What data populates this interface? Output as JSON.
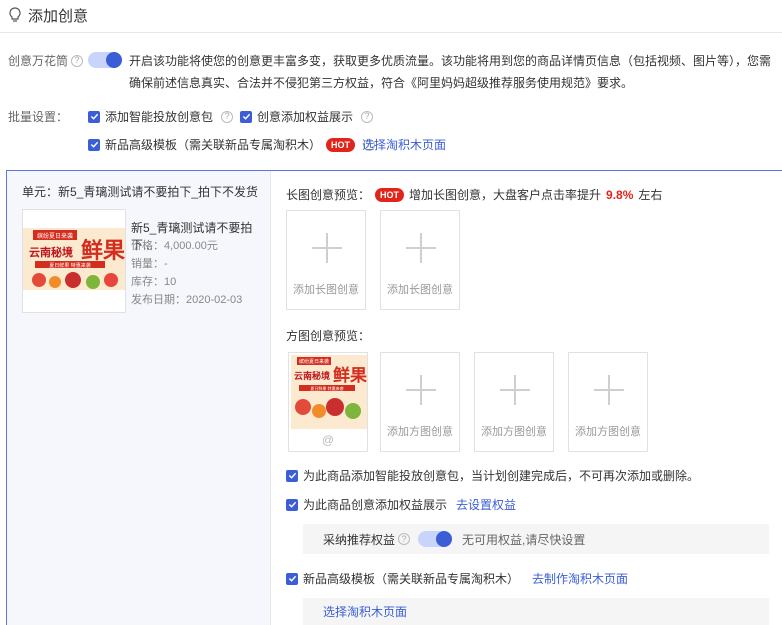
{
  "page": {
    "title": "添加创意"
  },
  "creative_kaleidoscope": {
    "label": "创意万花筒",
    "enabled": true,
    "description": "开启该功能将使您的创意更丰富多变，获取更多优质流量。该功能将用到您的商品详情页信息（包括视频、图片等），您需确保前述信息真实、合法并不侵犯第三方权益，符合《阿里妈妈超级推荐服务使用规范》要求。"
  },
  "batch": {
    "label": "批量设置：",
    "items": [
      {
        "label": "添加智能投放创意包",
        "checked": true
      },
      {
        "label": "创意添加权益展示",
        "checked": true
      },
      {
        "label": "新品高级模板（需关联新品专属淘积木）",
        "checked": true
      }
    ],
    "hot_badge": "HOT",
    "select_page_link": "选择淘积木页面"
  },
  "unit": {
    "title": "单元：新5_青璃测试请不要拍下_拍下不发货",
    "product": {
      "name": "新5_青璃测试请不要拍下...",
      "price": "价格：4,000.00元",
      "sales": "销量：-",
      "stock": "库存：10",
      "publish_date": "发布日期：2020-02-03",
      "image_text": {
        "tag": "缤纷夏日来袭",
        "main": "云南秘境",
        "big": "鲜果",
        "sub": "夏日鲜果 特惠来袭"
      }
    }
  },
  "long_preview": {
    "label": "长图创意预览：",
    "hot_badge": "HOT",
    "tip_prefix": "增加长图创意，大盘客户点击率提升",
    "tip_value": "9.8%",
    "tip_suffix": "左右",
    "slots": [
      "添加长图创意",
      "添加长图创意"
    ]
  },
  "square_preview": {
    "label": "方图创意预览：",
    "at_icon": "@",
    "slots": [
      "添加方图创意",
      "添加方图创意",
      "添加方图创意"
    ]
  },
  "options": {
    "smart_pack": {
      "checked": true,
      "label": "为此商品添加智能投放创意包，当计划创建完成后，不可再次添加或删除。"
    },
    "rights": {
      "checked": true,
      "label": "为此商品创意添加权益展示",
      "link": "去设置权益"
    },
    "rights_row": {
      "label": "采纳推荐权益",
      "enabled": true,
      "note": "无可用权益,请尽快设置"
    },
    "template": {
      "checked": true,
      "label": "新品高级模板（需关联新品专属淘积木）",
      "link": "去制作淘积木页面"
    },
    "select_page_link": "选择淘积木页面"
  },
  "colors": {
    "accent": "#3b5ed6",
    "hot": "#e1251b",
    "border": "#5b78e0"
  }
}
